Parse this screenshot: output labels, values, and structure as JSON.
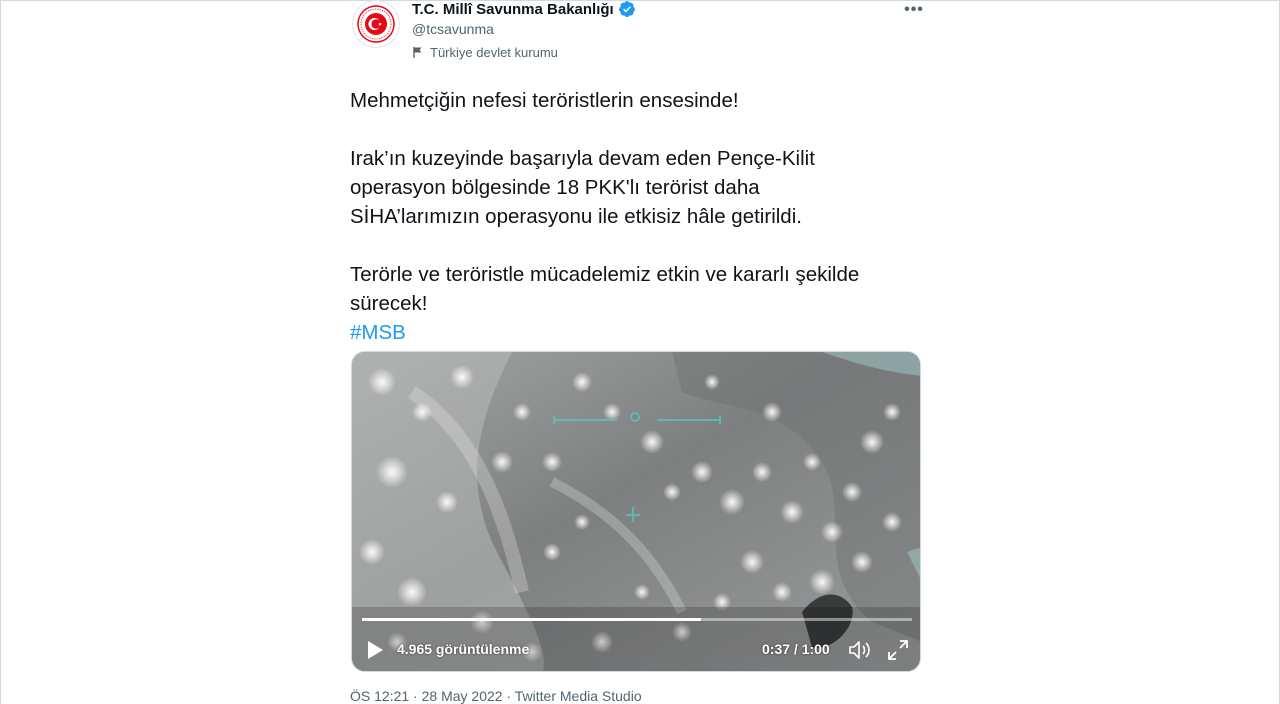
{
  "author": {
    "name": "T.C. Millî Savunma Bakanlığı",
    "handle": "@tcsavunma",
    "affiliation": "Türkiye devlet kurumu",
    "verified": true,
    "avatar_icon": "ministry-emblem-icon",
    "brand_color": "#e30a17"
  },
  "tweet": {
    "line1": "Mehmetçiğin nefesi teröristlerin ensesinde!",
    "para2": "Irak’ın kuzeyinde başarıyla devam eden Pençe-Kilit operasyon bölgesinde 18 PKK'lı terörist daha SİHA’larımızın operasyonu ile etkisiz hâle getirildi.",
    "para3": "Terörle ve teröristle mücadelemiz etkin ve kararlı şekilde sürecek!",
    "hashtag": "#MSB",
    "hashtag_color": "#1d9bf0"
  },
  "video": {
    "views": "4.965 görüntülenme",
    "time": "0:37 / 1:00",
    "progress": 0.617,
    "icons": [
      "play-icon",
      "volume-icon",
      "fullscreen-icon"
    ]
  },
  "meta": {
    "time": "ÖS 12:21",
    "separator": "·",
    "date": "28 May 2022",
    "source": "Twitter Media Studio"
  }
}
